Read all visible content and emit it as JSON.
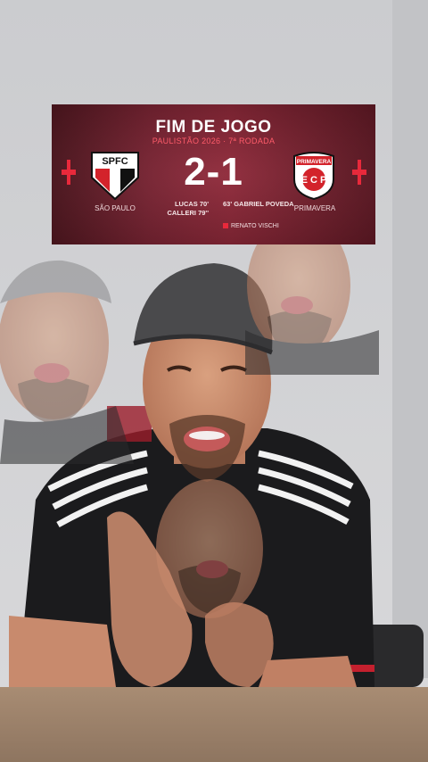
{
  "card": {
    "title": "FIM DE JOGO",
    "subtitle": "PAULISTÃO 2026 · 7ª RODADA",
    "score": "2-1",
    "home_team": "SÃO PAULO",
    "away_team": "PRIMAVERA",
    "home_crest_text": "SPFC",
    "away_crest_text": "PRIMAVERA",
    "home_scorers": [
      "LUCAS 70'",
      "CALLERI 79''"
    ],
    "away_scorers": [
      "63' GABRIEL POVEDA"
    ],
    "referee": "RENATO VISCHI"
  },
  "colors": {
    "card_primary": "#8e2536",
    "accent_red": "#e8293b",
    "subtitle": "#ff5c6a"
  }
}
